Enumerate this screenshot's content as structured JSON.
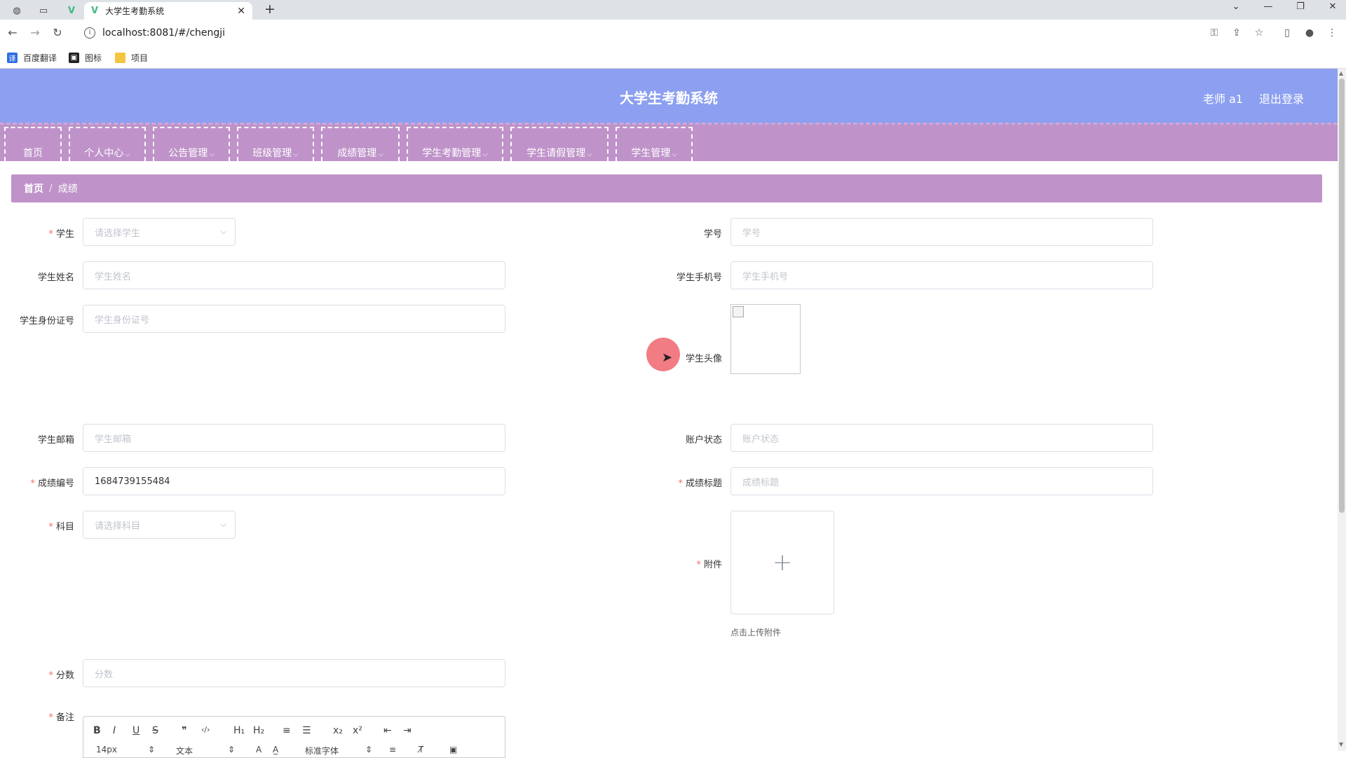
{
  "browser": {
    "tab_title": "大学生考勤系统",
    "url": "localhost:8081/#/chengji",
    "bookmarks": [
      {
        "label": "百度翻译",
        "icon": "translate-icon",
        "color": "#2f6de1"
      },
      {
        "label": "图标",
        "icon": "image-icon",
        "color": "#222222"
      },
      {
        "label": "项目",
        "icon": "folder-icon",
        "color": "#f4c542"
      }
    ]
  },
  "header": {
    "title": "大学生考勤系统",
    "user": "老师 a1",
    "logout": "退出登录",
    "color": "#8c9ff0"
  },
  "nav": {
    "items": [
      {
        "label": "首页",
        "has_dropdown": false
      },
      {
        "label": "个人中心",
        "has_dropdown": true
      },
      {
        "label": "公告管理",
        "has_dropdown": true
      },
      {
        "label": "班级管理",
        "has_dropdown": true
      },
      {
        "label": "成绩管理",
        "has_dropdown": true
      },
      {
        "label": "学生考勤管理",
        "has_dropdown": true
      },
      {
        "label": "学生请假管理",
        "has_dropdown": true
      },
      {
        "label": "学生管理",
        "has_dropdown": true
      }
    ],
    "color": "#bf93c9"
  },
  "breadcrumb": {
    "home": "首页",
    "current": "成绩"
  },
  "form": {
    "student": {
      "label": "学生",
      "placeholder": "请选择学生",
      "required": "*"
    },
    "student_no": {
      "label": "学号",
      "placeholder": "学号"
    },
    "student_name": {
      "label": "学生姓名",
      "placeholder": "学生姓名"
    },
    "student_phone": {
      "label": "学生手机号",
      "placeholder": "学生手机号"
    },
    "student_id_card": {
      "label": "学生身份证号",
      "placeholder": "学生身份证号"
    },
    "student_avatar": {
      "label": "学生头像"
    },
    "student_email": {
      "label": "学生邮箱",
      "placeholder": "学生邮箱"
    },
    "account_status": {
      "label": "账户状态",
      "placeholder": "账户状态"
    },
    "score_no": {
      "label": "成绩编号",
      "value": "1684739155484",
      "required": "*"
    },
    "score_title": {
      "label": "成绩标题",
      "placeholder": "成绩标题",
      "required": "*"
    },
    "subject": {
      "label": "科目",
      "placeholder": "请选择科目",
      "required": "*"
    },
    "attachment": {
      "label": "附件",
      "tip": "点击上传附件",
      "required": "*"
    },
    "score": {
      "label": "分数",
      "placeholder": "分数",
      "required": "*"
    },
    "remark": {
      "label": "备注",
      "required": "*"
    }
  },
  "editor": {
    "font_size": "14px",
    "text_style": "文本",
    "font_family": "标准字体",
    "buttons": [
      "B",
      "I",
      "U",
      "S",
      "❞",
      "‹/›",
      "H₁",
      "H₂",
      "≡",
      "☰",
      "x₂",
      "x²",
      "⇤",
      "⇥"
    ]
  }
}
